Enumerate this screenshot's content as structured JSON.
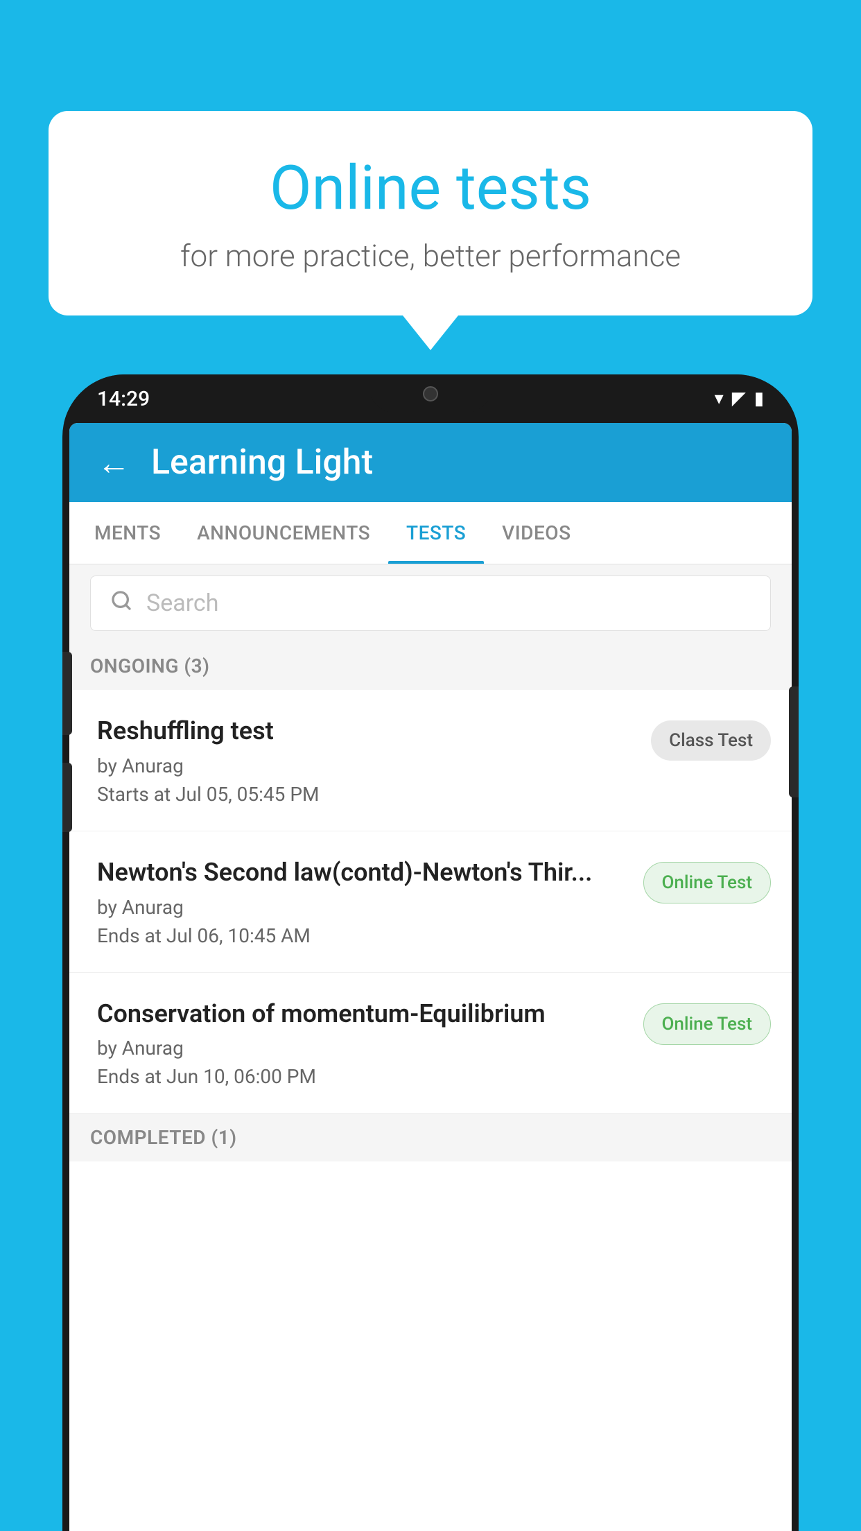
{
  "background_color": "#1ab8e8",
  "speech_bubble": {
    "title": "Online tests",
    "subtitle": "for more practice, better performance"
  },
  "phone": {
    "status_bar": {
      "time": "14:29",
      "wifi": "▾",
      "signal": "▴",
      "battery": "▮"
    },
    "header": {
      "title": "Learning Light",
      "back_label": "←"
    },
    "tabs": [
      {
        "label": "MENTS",
        "active": false
      },
      {
        "label": "ANNOUNCEMENTS",
        "active": false
      },
      {
        "label": "TESTS",
        "active": true
      },
      {
        "label": "VIDEOS",
        "active": false
      }
    ],
    "search": {
      "placeholder": "Search"
    },
    "ongoing_section": {
      "label": "ONGOING (3)",
      "items": [
        {
          "title": "Reshuffling test",
          "author": "by Anurag",
          "date": "Starts at  Jul 05, 05:45 PM",
          "badge": "Class Test",
          "badge_type": "class"
        },
        {
          "title": "Newton's Second law(contd)-Newton's Thir...",
          "author": "by Anurag",
          "date": "Ends at  Jul 06, 10:45 AM",
          "badge": "Online Test",
          "badge_type": "online"
        },
        {
          "title": "Conservation of momentum-Equilibrium",
          "author": "by Anurag",
          "date": "Ends at  Jun 10, 06:00 PM",
          "badge": "Online Test",
          "badge_type": "online"
        }
      ]
    },
    "completed_section": {
      "label": "COMPLETED (1)"
    }
  }
}
